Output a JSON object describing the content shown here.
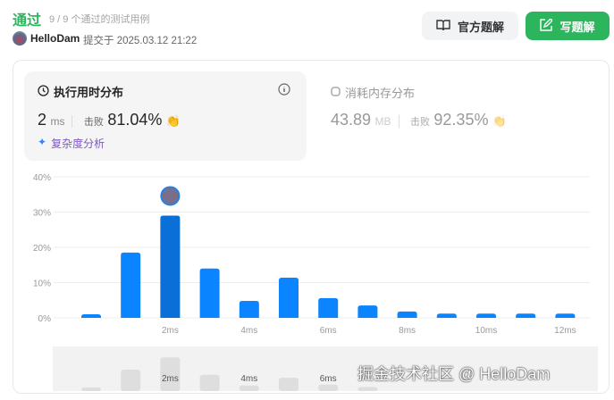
{
  "header": {
    "status": "通过",
    "cases": "9 / 9 个通过的测试用例",
    "user": "HelloDam",
    "submitted": "提交于 2025.03.12 21:22"
  },
  "buttons": {
    "official": "官方题解",
    "write": "写题解"
  },
  "runtime": {
    "title": "执行用时分布",
    "value": "2",
    "unit": "ms",
    "beat_label": "击败",
    "beat": "81.04%",
    "analysis": "复杂度分析"
  },
  "memory": {
    "title": "消耗内存分布",
    "value": "43.89",
    "unit": "MB",
    "beat_label": "击败",
    "beat": "92.35%"
  },
  "watermark": "掘金技术社区 @ HelloDam",
  "chart_data": {
    "type": "bar",
    "x": [
      0,
      1,
      2,
      3,
      4,
      5,
      6,
      7,
      8,
      9,
      10,
      11,
      12
    ],
    "values": [
      1,
      18.5,
      29,
      14,
      4.8,
      11.4,
      5.6,
      3.5,
      1.8,
      1.2,
      1.2,
      1.2,
      1.2
    ],
    "highlight_index": 2,
    "ylim": [
      0,
      40
    ],
    "yticks": [
      "0%",
      "10%",
      "20%",
      "30%",
      "40%"
    ],
    "xticks": [
      "2ms",
      "4ms",
      "6ms",
      "8ms",
      "10ms",
      "12ms"
    ],
    "xtick_values": [
      2,
      4,
      6,
      8,
      10,
      12
    ],
    "colors": {
      "bar": "#0a84ff",
      "highlight": "#0a6fd6"
    }
  }
}
